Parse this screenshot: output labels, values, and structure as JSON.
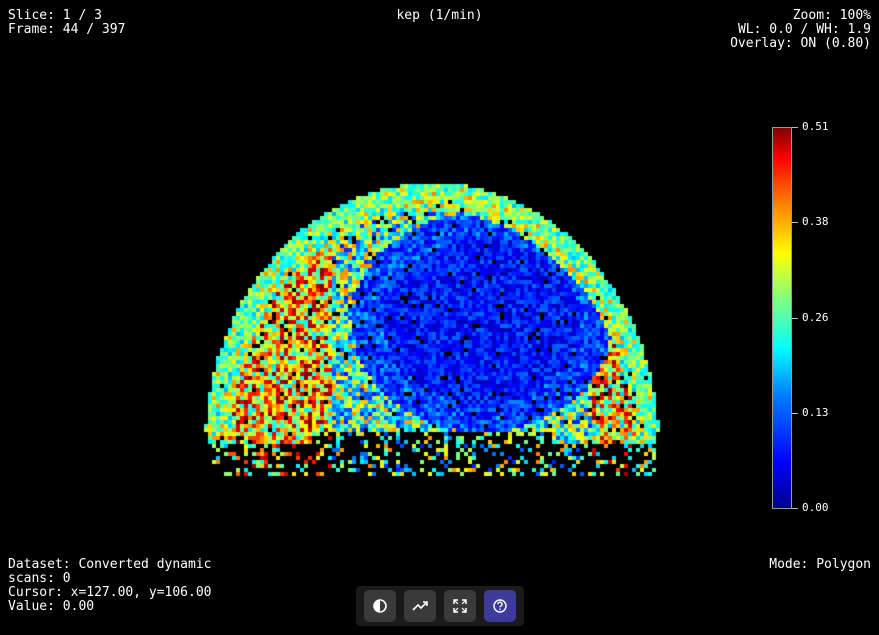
{
  "top_left": {
    "slice": "Slice: 1 / 3",
    "frame": "Frame: 44 / 397"
  },
  "top_center": {
    "map_title": "kep (1/min)"
  },
  "top_right": {
    "zoom": "Zoom: 100%",
    "window": "WL: 0.0 / WH: 1.9",
    "overlay": "Overlay: ON (0.80)"
  },
  "bottom_left": {
    "dataset_line1": "Dataset: Converted dynamic",
    "dataset_line2": "scans: 0",
    "cursor": "Cursor: x=127.00, y=106.00",
    "value": "Value: 0.00"
  },
  "bottom_right": {
    "mode": "Mode: Polygon"
  },
  "colorbar": {
    "colormap": "jet",
    "min": 0.0,
    "max": 0.51,
    "ticks": [
      "0.51",
      "0.38",
      "0.26",
      "0.13",
      "0.00"
    ]
  },
  "toolbar": {
    "buttons": [
      {
        "icon": "contrast-icon",
        "active": false
      },
      {
        "icon": "trend-chart-icon",
        "active": false
      },
      {
        "icon": "fullscreen-icon",
        "active": false
      },
      {
        "icon": "help-icon",
        "active": true
      }
    ]
  }
}
